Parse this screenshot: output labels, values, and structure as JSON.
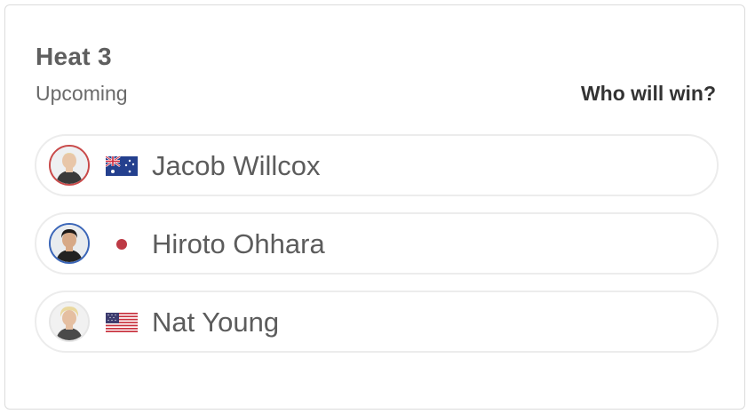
{
  "heat": {
    "title": "Heat 3",
    "status": "Upcoming",
    "prompt": "Who will win?"
  },
  "athletes": [
    {
      "name": "Jacob Willcox",
      "flag_icon": "australia-flag-icon",
      "ring_color": "#c94a4a"
    },
    {
      "name": "Hiroto Ohhara",
      "flag_icon": "japan-flag-icon",
      "ring_color": "#3b66b8"
    },
    {
      "name": "Nat Young",
      "flag_icon": "usa-flag-icon",
      "ring_color": "#e6e6e6"
    }
  ]
}
